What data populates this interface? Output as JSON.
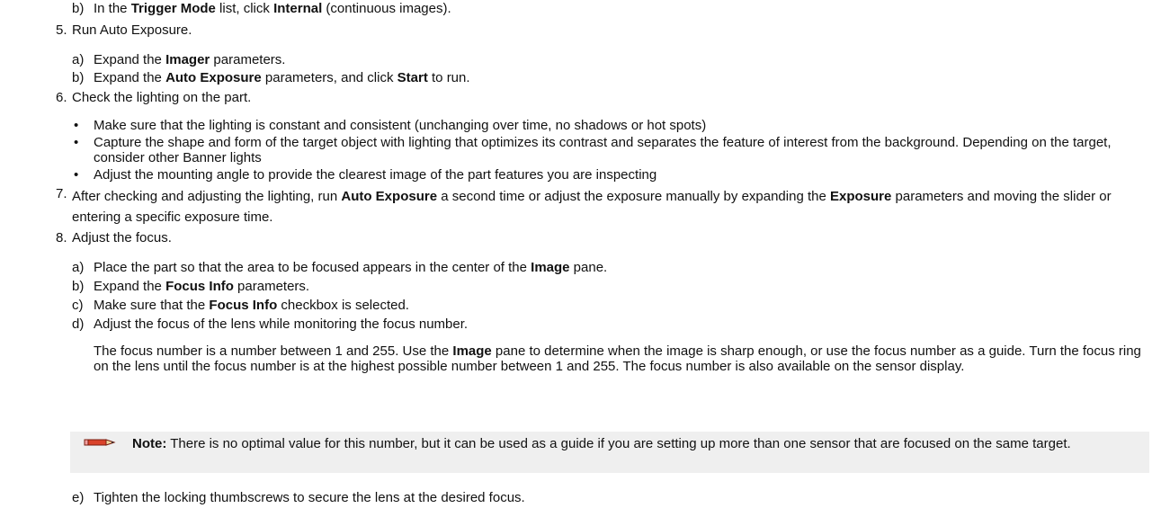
{
  "item4b": {
    "marker": "b)",
    "parts": [
      "In the ",
      "Trigger Mode",
      " list, click ",
      "Internal",
      " (continuous images)."
    ]
  },
  "step5": {
    "marker": "5.",
    "title": "Run Auto Exposure.",
    "a": {
      "marker": "a)",
      "parts": [
        "Expand the ",
        "Imager",
        " parameters."
      ]
    },
    "b": {
      "marker": "b)",
      "parts": [
        "Expand the ",
        "Auto Exposure",
        " parameters, and click ",
        "Start",
        " to run."
      ]
    }
  },
  "step6": {
    "marker": "6.",
    "title": "Check the lighting on the part.",
    "bullets": [
      "Make sure that the lighting is constant and consistent (unchanging over time, no shadows or hot spots)",
      "Capture the shape and form of the target object with lighting that optimizes its contrast and separates the feature of interest from the background. Depending on the target, consider other Banner lights",
      "Adjust the mounting angle to provide the clearest image of the part features you are inspecting"
    ],
    "bullet_char": "•"
  },
  "step7": {
    "marker": "7.",
    "parts": [
      "After checking and adjusting the lighting, run ",
      "Auto Exposure",
      " a second time or adjust the exposure manually by expanding the ",
      "Exposure",
      " parameters and moving the slider or entering a specific exposure time."
    ]
  },
  "step8": {
    "marker": "8.",
    "title": "Adjust the focus.",
    "a": {
      "marker": "a)",
      "parts": [
        "Place the part so that the area to be focused appears in the center of the ",
        "Image",
        " pane."
      ]
    },
    "b": {
      "marker": "b)",
      "parts": [
        "Expand the ",
        "Focus Info",
        " parameters."
      ]
    },
    "c": {
      "marker": "c)",
      "parts": [
        "Make sure that the ",
        "Focus Info",
        " checkbox is selected."
      ]
    },
    "d": {
      "marker": "d)",
      "text": "Adjust the focus of the lens while monitoring the focus number."
    },
    "d_para": {
      "parts": [
        "The focus number is a number between 1 and 255. Use the ",
        "Image",
        " pane to determine when the image is sharp enough, or use the focus number as a guide. Turn the focus ring on the lens until the focus number is at the highest possible number between 1 and 255. The focus number is also available on the sensor display."
      ]
    },
    "note": {
      "label": "Note:",
      "text": " There is no optimal value for this number, but it can be used as a guide if you are setting up more than one sensor that are focused on the same target.",
      "icon": "pencil-icon"
    },
    "e": {
      "marker": "e)",
      "text": "Tighten the locking thumbscrews to secure the lens at the desired focus."
    }
  }
}
